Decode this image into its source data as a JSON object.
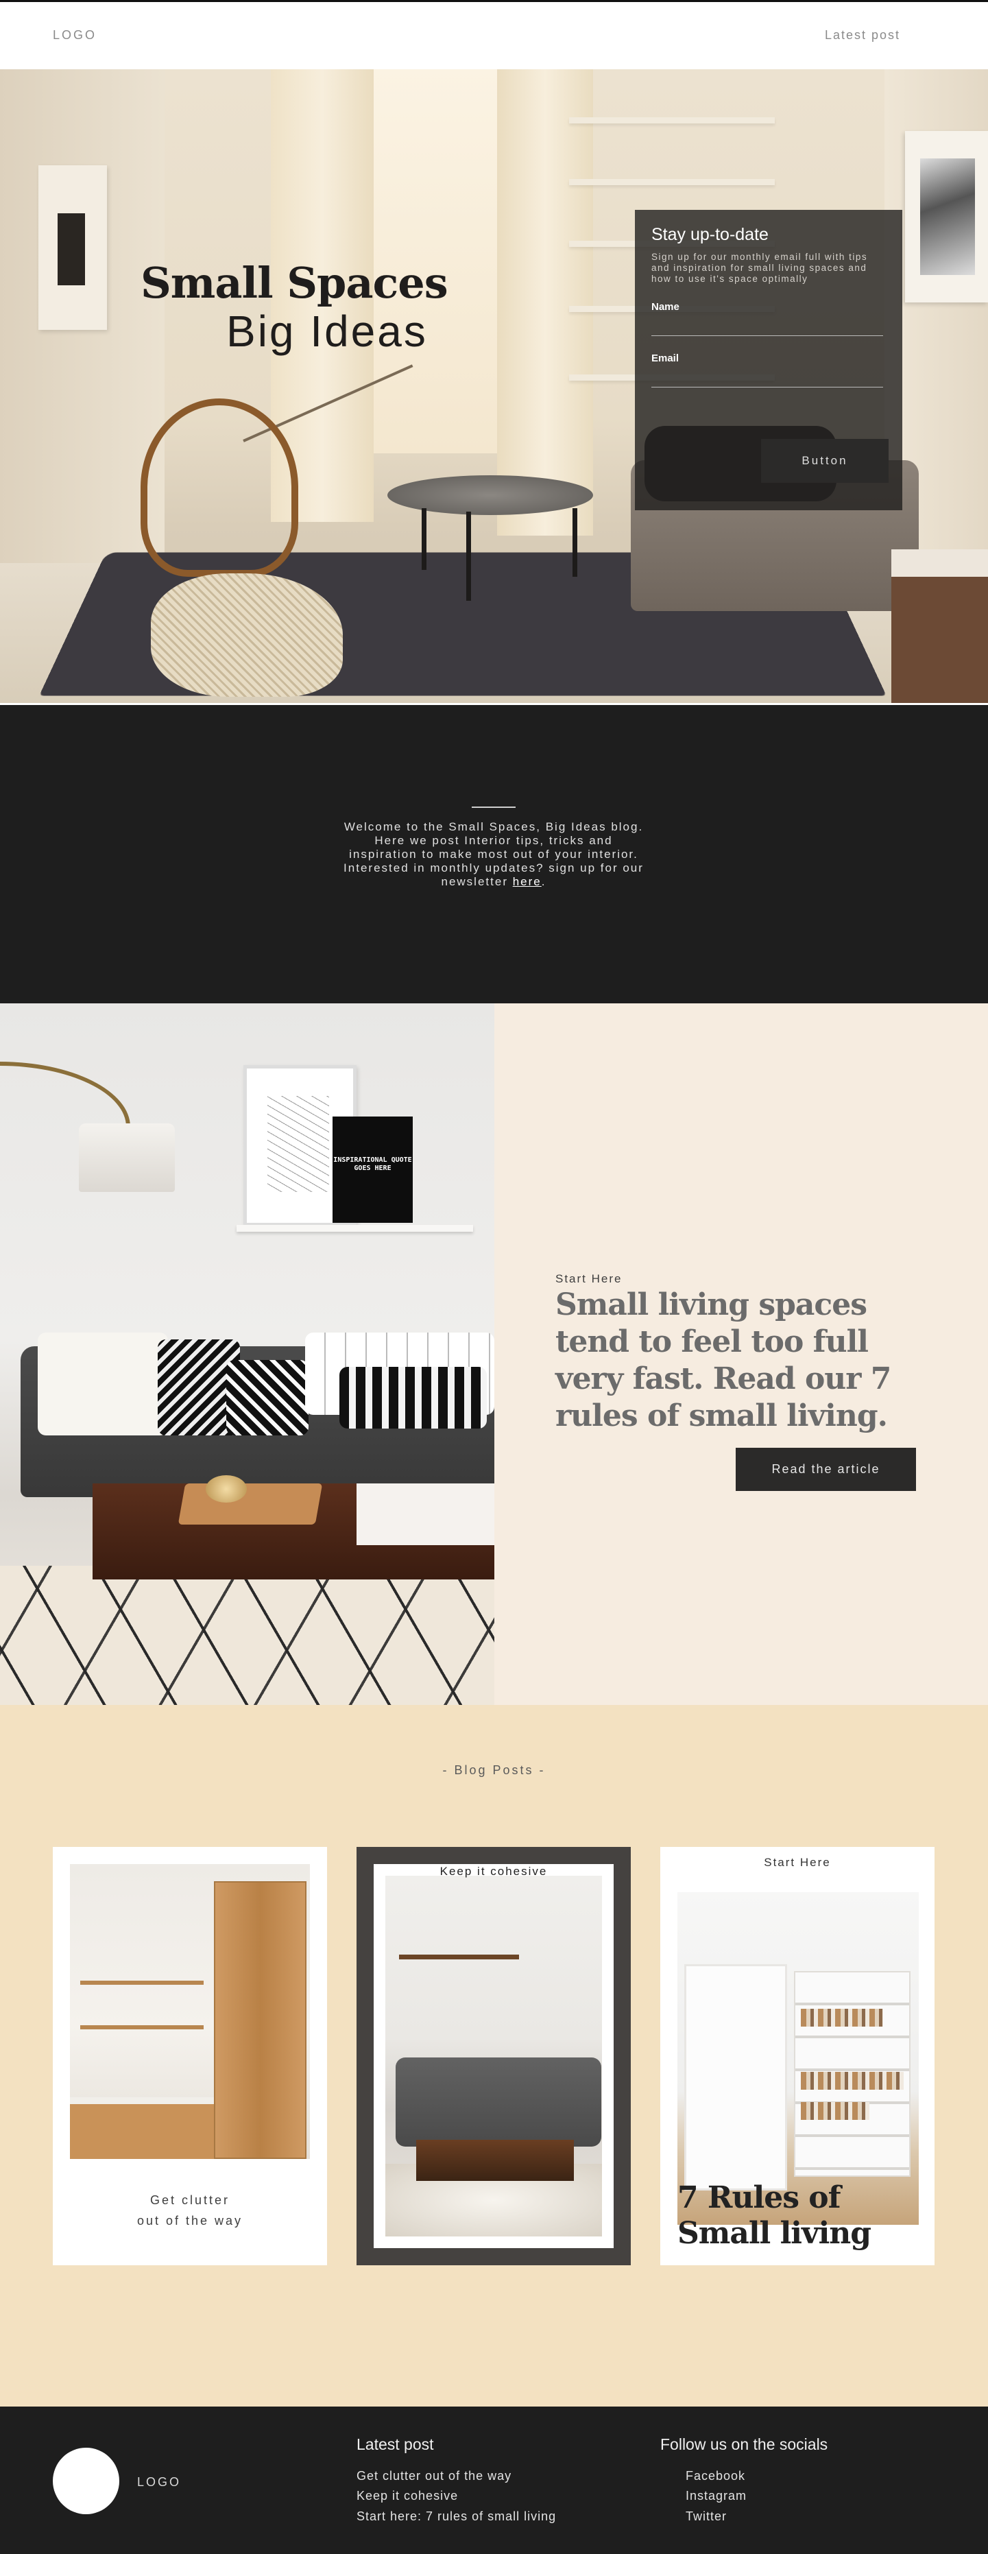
{
  "header": {
    "logo": "LOGO",
    "nav_latest": "Latest post"
  },
  "hero": {
    "title": "Small Spaces",
    "subtitle": "Big Ideas",
    "signup": {
      "heading": "Stay up-to-date",
      "description": "Sign up for our monthly email full with tips and inspiration for small living spaces and how to use it's space optimally",
      "name_label": "Name",
      "email_label": "Email",
      "button_label": "Button"
    }
  },
  "welcome": {
    "text": "Welcome to the Small Spaces, Big Ideas blog. Here we post Interior tips, tricks and inspiration to make most out of your interior. Interested in monthly updates? sign up for our newsletter",
    "link": "here",
    "after_link": "."
  },
  "feature": {
    "label": "Start Here",
    "heading": "Small living spaces tend to feel too full very fast. Read our 7 rules of small living.",
    "button_label": "Read the article",
    "quote_board": "INSPIRATIONAL QUOTE GOES HERE"
  },
  "blog": {
    "title": "- Blog Posts -",
    "cards": [
      {
        "caption_line1": "Get clutter",
        "caption_line2": "out of the way"
      },
      {
        "label": "Keep it cohesive"
      },
      {
        "label": "Start Here",
        "title": "7 Rules of Small living"
      }
    ]
  },
  "footer": {
    "logo": "LOGO",
    "latest_title": "Latest post",
    "latest_links": [
      "Get clutter out of the way",
      "Keep it cohesive",
      "Start here: 7 rules of small living"
    ],
    "social_title": "Follow us on the socials",
    "social_links": [
      "Facebook",
      "Instagram",
      "Twitter"
    ]
  },
  "colors": {
    "dark": "#1e1e1e",
    "cream": "#f6ece0",
    "sand": "#f3e1c1",
    "button": "#2b2a29"
  }
}
